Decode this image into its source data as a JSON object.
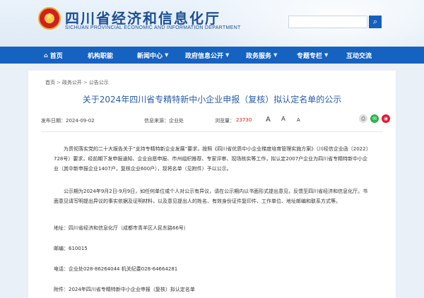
{
  "header": {
    "title": "四川省经济和信息化厅",
    "subtitle": "SICHUAN PROVINCIAL ECONOMIC AND INFORMATION DEPARTMENT",
    "search_placeholder": "",
    "search_icon": "search-icon"
  },
  "nav": {
    "items": [
      {
        "label": "首页",
        "icon": "home-icon"
      },
      {
        "label": "机构职能"
      },
      {
        "label": "新闻中心"
      },
      {
        "label": "政府信息公开"
      },
      {
        "label": "政务服务"
      },
      {
        "label": "专题专栏"
      },
      {
        "label": "互动交流"
      }
    ]
  },
  "breadcrumb": [
    "首页",
    "政务公开",
    "公告公示"
  ],
  "article": {
    "title": "关于2024年四川省专精特新中小企业申报（复核）拟认定名单的公示",
    "publish_label": "发布日期：2024-09-02",
    "source_label": "信息来源：企业处",
    "views_label": "浏览量：",
    "views": "23730",
    "font_controls": [
      "A",
      "A",
      "A"
    ],
    "paragraphs": [
      "为贯彻落实党的二十大报告关于“支持专精特新企业发展”要求，按照《四川省优质中小企业梯度培育管理实施方案》（川经信企业函〔2022〕728号）要求，经前期下发申报通知、企业自愿申报、市州组织推荐、专家评审、现场核实等工作，拟认定2007户企业为四川省专精特新中小企业（其中新申报企业1407户，复核企业600户），现将名单（见附件）予以公示。",
      "公示期为2024年9月2日-9月9日，如任何单位或个人对公示有异议，请在公示期内以书面形式提出意见，反馈至四川省经济和信息化厅。书面意见请写明提出异议的事实依据及证明材料，以及意见提出人的姓名、有效身份证件复印件、工作单位、地址邮编和联系方式等。",
      "地址：四川省经济和信息化厅（成都市青羊区人民东路66号）",
      "邮编：610015",
      "电话：企业处028-86264044  机关纪委028-64664281",
      "附件：2024年四川省专精特新中小企业申报（复核）拟认定名单"
    ]
  },
  "colors": {
    "nav_bg": "#1662c1",
    "title_blue": "#2a5ca8",
    "views_red": "#d81e06"
  }
}
